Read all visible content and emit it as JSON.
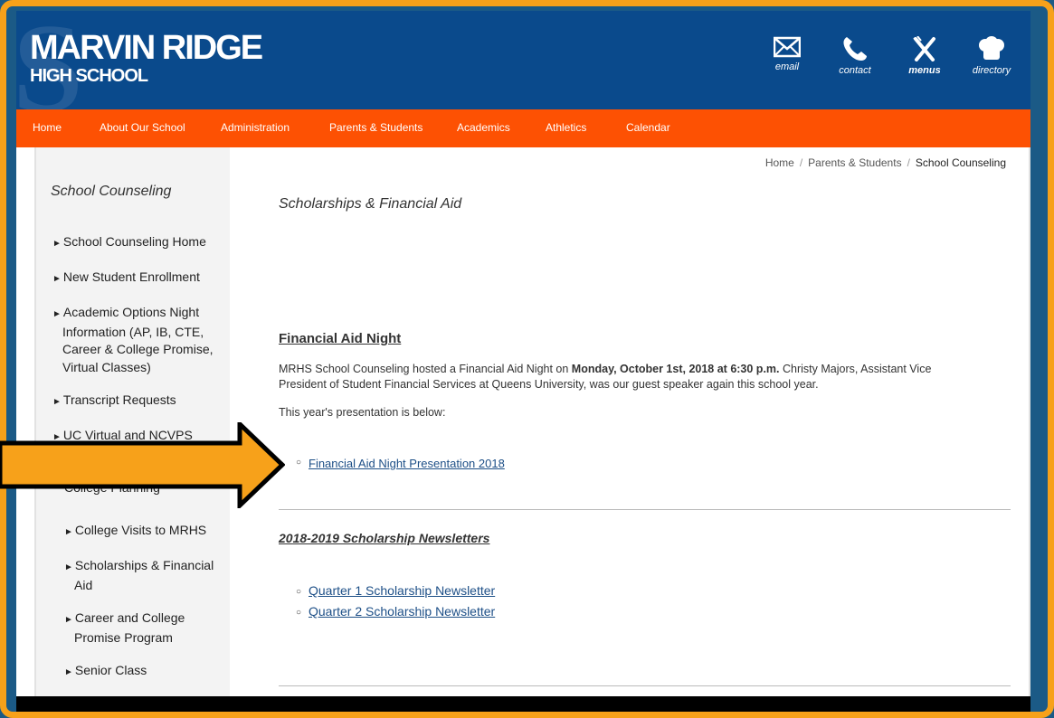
{
  "header": {
    "logo_line1": "MARVIN RIDGE",
    "logo_line2": "HIGH SCHOOL",
    "icons": [
      {
        "icon": "envelope-icon",
        "label": "email"
      },
      {
        "icon": "phone-icon",
        "label": "contact"
      },
      {
        "icon": "fork-knife-icon",
        "label": "menus"
      },
      {
        "icon": "chef-hat-icon",
        "label": "directory"
      }
    ]
  },
  "nav": [
    "Home",
    "About Our School",
    "Administration",
    "Parents & Students",
    "Academics",
    "Athletics",
    "Calendar"
  ],
  "breadcrumb": [
    "Home",
    "Parents & Students",
    "School Counseling"
  ],
  "sidebar": {
    "title": "School Counseling",
    "items": [
      "School Counseling Home",
      "New Student Enrollment",
      "Academic Options Night Information (AP, IB, CTE, Career & College Promise, Virtual Classes)",
      "Transcript Requests",
      "UC Virtual and NCVPS",
      "College Planning",
      "College Visits to MRHS",
      "Scholarships & Financial Aid",
      "Career and College Promise Program",
      "Senior Class"
    ]
  },
  "main": {
    "title": "Scholarships & Financial Aid",
    "section1": {
      "heading": "Financial Aid Night",
      "p1_pre": "MRHS School Counseling hosted a Financial Aid Night on ",
      "p1_bold": "Monday, October 1st, 2018 at 6:30 p.m.",
      "p1_post": " Christy Majors, Assistant Vice President of Student Financial Services at Queens University, was our guest speaker again this school year.",
      "p2": "This year's presentation is below:",
      "link": "Financial Aid Night Presentation 2018"
    },
    "section2": {
      "heading": "2018-2019 Scholarship Newsletters",
      "links": [
        "Quarter 1 Scholarship Newsletter",
        "Quarter 2 Scholarship Newsletter"
      ]
    }
  },
  "colors": {
    "frame": "#f7a11a",
    "header": "#0a4a8c",
    "nav": "#fd5103",
    "link": "#1d4f87",
    "arrow": "#f7a11a"
  }
}
